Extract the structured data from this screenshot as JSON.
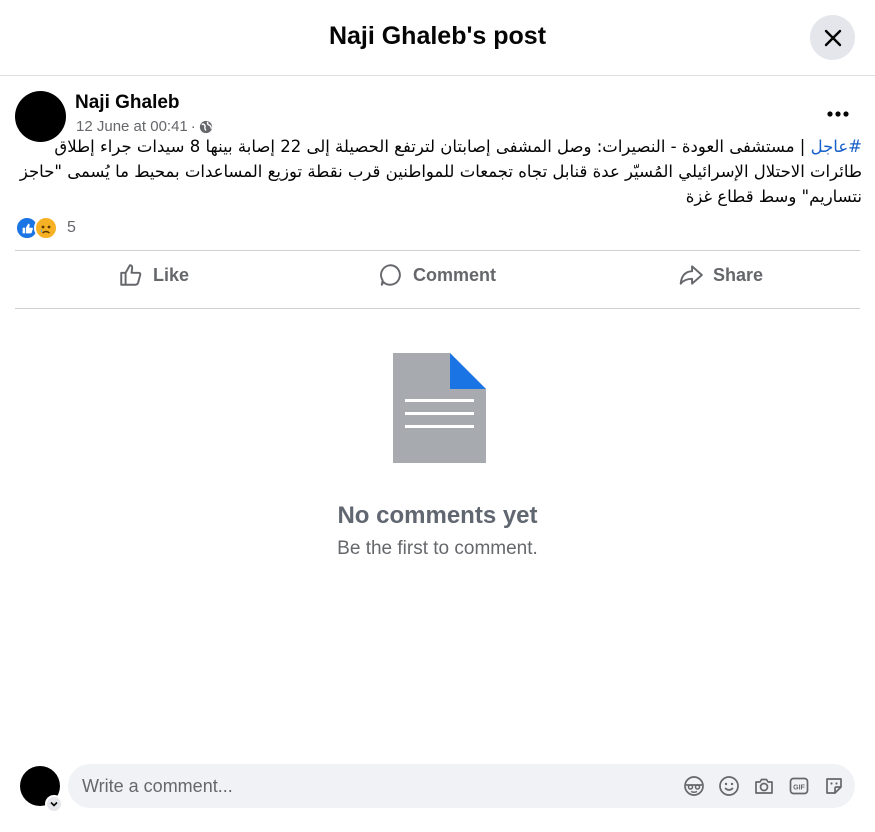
{
  "dialog": {
    "title": "Naji Ghaleb's post"
  },
  "post": {
    "author": "Naji Ghaleb",
    "timestamp": "12 June at 00:41",
    "meta_separator": "·",
    "audience_icon": "globe-icon",
    "hashtag": "#عاجل",
    "text": " | مستشفى العودة - النصيرات: وصل المشفى إصابتان لترتفع الحصيلة إلى 22 إصابة بينها 8 سيدات جراء إطلاق طائرات الاحتلال الإسرائيلي المُسيّر عدة قنابل تجاه تجمعات للمواطنين قرب نقطة توزيع المساعدات بمحيط ما يُسمى \"حاجز نتساريم\" وسط قطاع غزة",
    "reactions": {
      "icons": [
        "like-icon",
        "sad-icon"
      ],
      "count": "5"
    }
  },
  "actions": {
    "like": "Like",
    "comment": "Comment",
    "share": "Share"
  },
  "comments": {
    "empty_icon": "document-icon",
    "empty_title": "No comments yet",
    "empty_subtitle": "Be the first to comment."
  },
  "composer": {
    "placeholder": "Write a comment...",
    "icons": [
      "avatar-sticker-icon",
      "emoji-icon",
      "camera-icon",
      "gif-icon",
      "sticker-icon"
    ]
  },
  "colors": {
    "accent": "#1b74e4",
    "hashtag": "#1760c7",
    "muted_text": "#65676b",
    "sad_reaction": "#f7b125"
  }
}
